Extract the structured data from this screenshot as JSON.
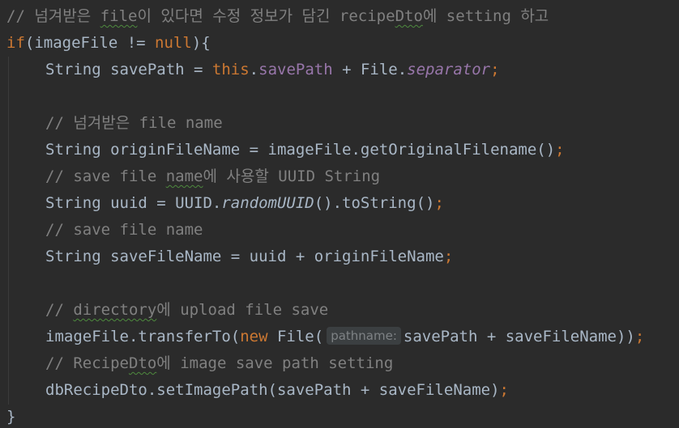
{
  "code": {
    "l1_comment_a": "// 넘겨받은 ",
    "l1_comment_typo1": "file",
    "l1_comment_b": "이 있다면 수정 정보가 담긴 recipe",
    "l1_comment_typo2": "Dto",
    "l1_comment_c": "에 setting 하고",
    "l2_if": "if",
    "l2_a": "(imageFile != ",
    "l2_null": "null",
    "l2_b": "){",
    "l3_a": "String savePath = ",
    "l3_this": "this",
    "l3_dot": ".",
    "l3_field": "savePath",
    "l3_b": " + File.",
    "l3_sep": "separator",
    "l3_semi": ";",
    "l5_comment": "// 넘겨받은 file name",
    "l6_a": "String originFileName = imageFile.getOriginalFilename()",
    "l6_semi": ";",
    "l7_comment_a": "// save file ",
    "l7_comment_typo": "name",
    "l7_comment_b": "에 사용할 UUID String",
    "l8_a": "String uuid = UUID.",
    "l8_method": "randomUUID",
    "l8_b": "().toString()",
    "l8_semi": ";",
    "l9_comment": "// save file name",
    "l10_a": "String saveFileName = uuid + originFileName",
    "l10_semi": ";",
    "l12_comment_a": "// ",
    "l12_comment_typo": "directory",
    "l12_comment_b": "에 upload file save",
    "l13_a": "imageFile.transferTo(",
    "l13_new": "new",
    "l13_b": " File(",
    "l13_hint": "pathname:",
    "l13_c": "savePath + saveFileName))",
    "l13_semi": ";",
    "l14_comment_a": "// Recipe",
    "l14_comment_typo": "Dto",
    "l14_comment_b": "에 image save path setting",
    "l15_a": "dbRecipeDto.setImagePath(savePath + saveFileName)",
    "l15_semi": ";",
    "l16_close": "}"
  },
  "colors": {
    "background": "#2b2b2b",
    "text": "#a9b7c6",
    "comment": "#808080",
    "keyword": "#cc7832",
    "field": "#9876aa",
    "hint_bg": "#3b3f41"
  }
}
